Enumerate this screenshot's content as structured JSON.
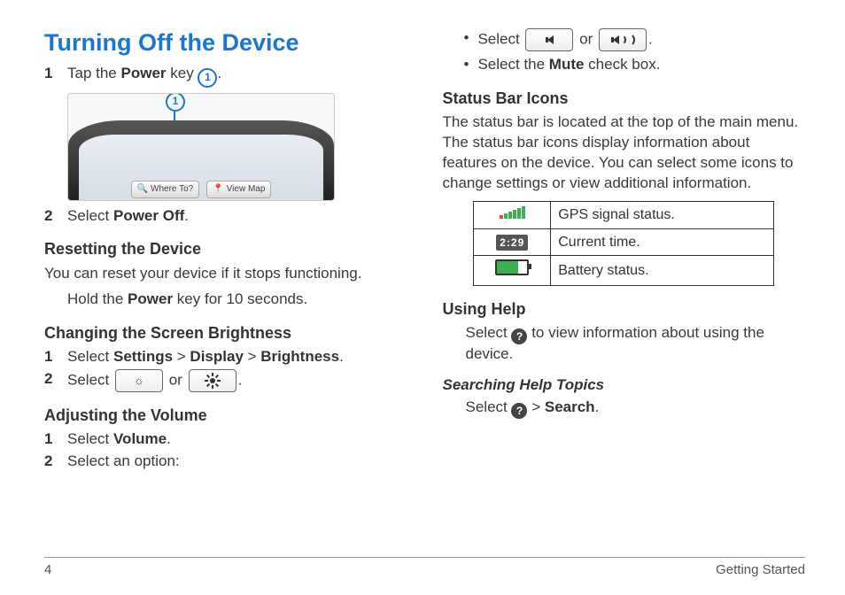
{
  "page_number": "4",
  "footer_section": "Getting Started",
  "left": {
    "title": "Turning Off the Device",
    "step1_num": "1",
    "step1_pre": "Tap the ",
    "step1_bold": "Power",
    "step1_post": " key ",
    "step1_circ": "1",
    "device": {
      "callout_circ": "1",
      "btn_where": "Where To?",
      "btn_map": "View Map"
    },
    "step2_num": "2",
    "step2_pre": "Select ",
    "step2_bold": "Power Off",
    "reset_head": "Resetting the Device",
    "reset_body": "You can reset your device if it stops functioning.",
    "reset_action_pre": "Hold the ",
    "reset_action_bold": "Power",
    "reset_action_post": " key for 10 seconds.",
    "bright_head": "Changing the Screen Brightness",
    "bright_s1_num": "1",
    "bright_s1_pre": "Select ",
    "bright_s1_b1": "Settings",
    "bright_s1_sep1": " > ",
    "bright_s1_b2": "Display",
    "bright_s1_sep2": " > ",
    "bright_s1_b3": "Brightness",
    "bright_s2_num": "2",
    "bright_s2_pre": "Select ",
    "bright_s2_mid": " or ",
    "vol_head": "Adjusting the Volume",
    "vol_s1_num": "1",
    "vol_s1_pre": "Select ",
    "vol_s1_bold": "Volume",
    "vol_s2_num": "2",
    "vol_s2_txt": "Select an option:"
  },
  "right": {
    "opt1_pre": "Select ",
    "opt1_mid": " or ",
    "opt2_pre": "Select the ",
    "opt2_bold": "Mute",
    "opt2_post": " check box.",
    "status_head": "Status Bar Icons",
    "status_body": "The status bar is located at the top of the main menu. The status bar icons display information about features on the device. You can select some icons to change settings or view additional information.",
    "tbl_gps": "GPS signal status.",
    "tbl_time_val": "2:29",
    "tbl_time": "Current time.",
    "tbl_batt": "Battery status.",
    "help_head": "Using Help",
    "help_pre": "Select ",
    "help_post": " to view information about using the device.",
    "search_head": "Searching Help Topics",
    "search_pre": "Select ",
    "search_sep": " > ",
    "search_bold": "Search"
  }
}
